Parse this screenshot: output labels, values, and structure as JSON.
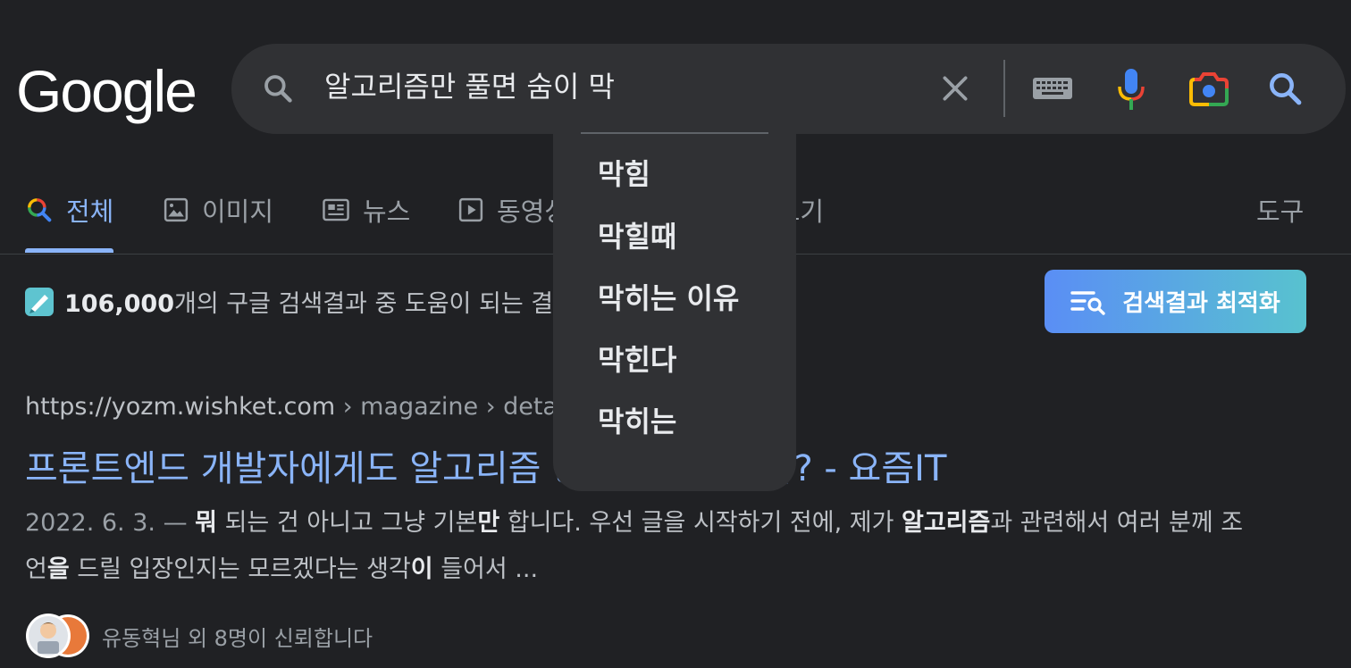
{
  "logo": {
    "text": "Google"
  },
  "search": {
    "query": "알고리즘만 풀면 숨이 막"
  },
  "suggestions": [
    "막힘",
    "막힐때",
    "막히는 이유",
    "막힌다",
    "막히는"
  ],
  "tabs": {
    "all": "전체",
    "images": "이미지",
    "news": "뉴스",
    "videos": "동영상",
    "more": "더보기",
    "tools": "도구"
  },
  "stats": {
    "count": "106,000",
    "text": "개의 구글 검색결과 중 도움이 되는 결과"
  },
  "optimize_button": {
    "label": "검색결과 최적화"
  },
  "result": {
    "url_host": "https://yozm.wishket.com",
    "url_path": " › magazine › detail",
    "title": "프론트엔드 개발자에게도 알고리즘 공부가 필요한가? - 요즘IT",
    "date": "2022. 6. 3. — ",
    "snippet_parts": [
      {
        "t": "뭐",
        "b": true
      },
      {
        "t": " 되는 건 아니고 그냥 기본",
        "b": false
      },
      {
        "t": "만",
        "b": true
      },
      {
        "t": " 합니다. 우선 글을 시작하기 전에, 제가 ",
        "b": false
      },
      {
        "t": "알고리즘",
        "b": true
      },
      {
        "t": "과 관련해서 여러 분께 조언",
        "b": false
      },
      {
        "t": "을",
        "b": true
      },
      {
        "t": " 드릴 입장인지는 모르겠다는 생각",
        "b": false
      },
      {
        "t": "이",
        "b": true
      },
      {
        "t": " 들어서 ...",
        "b": false
      }
    ],
    "trust_text": "유동혁님 외 8명이 신뢰합니다"
  },
  "colors": {
    "background": "#202124",
    "link": "#8ab4f8",
    "surface": "#303134"
  },
  "icons": {
    "search": "search-icon",
    "clear": "close-icon",
    "keyboard": "keyboard-icon",
    "mic": "mic-icon",
    "camera": "lens-camera-icon"
  }
}
